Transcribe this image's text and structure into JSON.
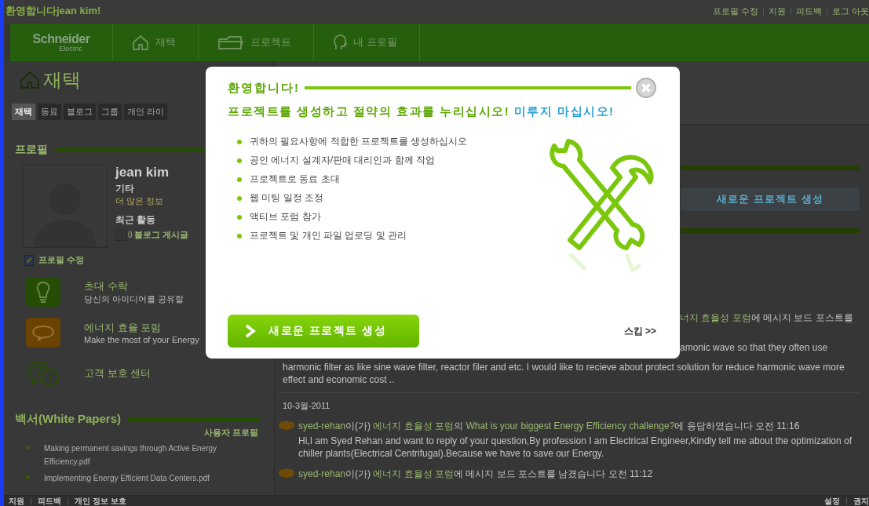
{
  "top_bar": {
    "greeting": "환영합니다jean kim!",
    "links": [
      "프로필 수정",
      "지원",
      "피드백",
      "로그 아웃"
    ]
  },
  "nav": {
    "logo": {
      "name": "Schneider",
      "sub": "Electric"
    },
    "items": [
      {
        "kind": "home",
        "label": "재택"
      },
      {
        "kind": "folder",
        "label": "프로젝트"
      },
      {
        "kind": "head",
        "label": "내 프로필"
      }
    ]
  },
  "page_title": "재택",
  "tabs": [
    {
      "label": "재택",
      "selected": true
    },
    {
      "label": "동료",
      "selected": false
    },
    {
      "label": "블로그",
      "selected": false
    },
    {
      "label": "그룹",
      "selected": false
    },
    {
      "label": "개인 라이",
      "selected": false
    }
  ],
  "profile": {
    "heading": "프로필",
    "name": "jean kim",
    "role": "기타",
    "more_link": "더 많은 정보",
    "activity_label": "최근 활동",
    "activity_count": "0",
    "activity_link": "블로그 게시글",
    "edit_link": "프로필 수정"
  },
  "features": [
    {
      "kind": "bulb",
      "title": "초대 수락",
      "subtitle": "당신의 아이디어를 공유할"
    },
    {
      "kind": "chat",
      "title": "에너지 효율 포럼",
      "subtitle": "Make the most of your Energy"
    },
    {
      "kind": "help",
      "title": "고객 보호 센터"
    }
  ],
  "white_papers": {
    "heading": "백서(White Papers)",
    "link": "사용자 프로필",
    "items": [
      "Making permanent savings through Active Energy Efficiency.pdf",
      "Implementing Energy Efficient Data Centers.pdf"
    ]
  },
  "side_panel": {
    "button": "새로운 프로젝트 생성"
  },
  "feed": {
    "cut_item": {
      "forum": "너지 효율성 포럼",
      "action": "에 메시지 보드 포스트를",
      "body_end": "amonic wave so that they often use",
      "body": "harmonic filter as like sine wave filter, reactor filer and etc. I would like to recieve about protect solution for reduce harmonic wave more effect and economic cost .."
    },
    "date": "10-3월-2011",
    "items": [
      {
        "parts": [
          {
            "kind": "user",
            "text": "syed-rehan"
          },
          {
            "kind": "plain",
            "text": "이(가) "
          },
          {
            "kind": "forum",
            "text": "에너지 효율성 포럼"
          },
          {
            "kind": "plain",
            "text": "의 "
          },
          {
            "kind": "topic",
            "text": "What is your biggest Energy Efficiency challenge?"
          },
          {
            "kind": "plain",
            "text": "에 응답하였습니다 오전 11:16"
          }
        ],
        "body": "Hi,I am Syed Rehan and want to reply of your question,By profession I am Electrical Engineer,Kindly tell me about the optimization of chiller plants(Electrical Centrifugal).Because we have to save our Energy."
      },
      {
        "parts": [
          {
            "kind": "user",
            "text": "syed-rehan"
          },
          {
            "kind": "plain",
            "text": "이(가) "
          },
          {
            "kind": "forum",
            "text": "에너지 효율성 포럼"
          },
          {
            "kind": "plain",
            "text": "에 메시지 보드 포스트를 남겼습니다 오전 11:12"
          }
        ]
      }
    ]
  },
  "footer": {
    "left_links": [
      "지원",
      "피드백",
      "개인 정보 보호"
    ],
    "right_links": [
      "설정",
      "권지"
    ]
  },
  "modal": {
    "title": "환영합니다!",
    "lead": "프로젝트를 생성하고 절약의 효과를 누리십시오!",
    "emphasis": "미루지 마십시오!",
    "bullets": [
      "귀하의 필요사항에 적합한 프로젝트를 생성하십시오",
      "공인 에너지 설계자/판매 대리인과 함께 작업",
      "프로젝트로 동료 초대",
      "웹 미팅 일정 조정",
      "액티브 포럼 참가",
      "프로젝트 및 개인 파일 업로딩 및 관리"
    ],
    "button": "새로운 프로젝트 생성",
    "skip": "스킵 >>"
  }
}
